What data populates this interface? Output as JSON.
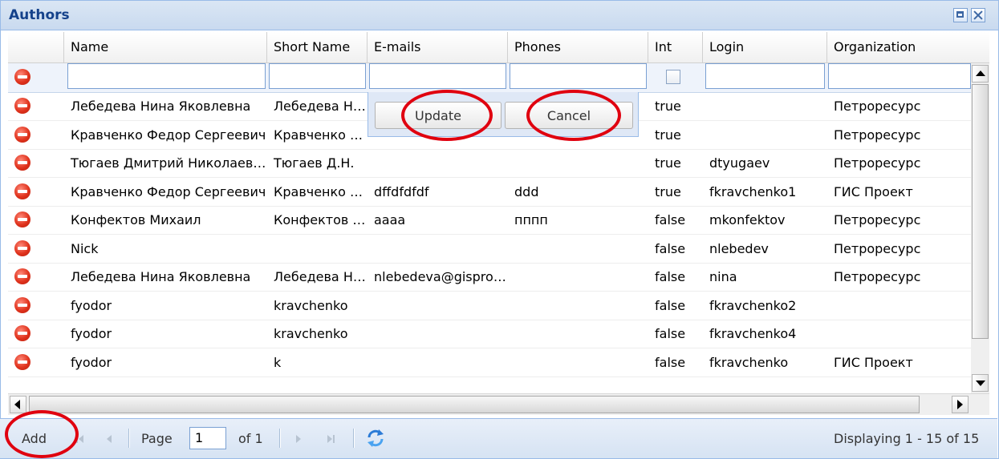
{
  "panel": {
    "title": "Authors"
  },
  "columns": [
    {
      "key": "del",
      "label": ""
    },
    {
      "key": "name",
      "label": "Name"
    },
    {
      "key": "short",
      "label": "Short Name"
    },
    {
      "key": "emails",
      "label": "E-mails"
    },
    {
      "key": "phones",
      "label": "Phones"
    },
    {
      "key": "int",
      "label": "Int"
    },
    {
      "key": "login",
      "label": "Login"
    },
    {
      "key": "org",
      "label": "Organization"
    }
  ],
  "rows": [
    {
      "name": "Лебедева Нина Яковлевна",
      "short": "Лебедева Н.Я.",
      "emails": "",
      "phones": "",
      "int": "true",
      "login": "",
      "org": "Петроресурс"
    },
    {
      "name": "Кравченко Федор Сергеевич",
      "short": "Кравченко Ф.С.",
      "emails": "",
      "phones": "",
      "int": "true",
      "login": "",
      "org": "Петроресурс"
    },
    {
      "name": "Тюгаев Дмитрий Николаевич",
      "short": "Тюгаев Д.Н.",
      "emails": "",
      "phones": "",
      "int": "true",
      "login": "dtyugaev",
      "org": "Петроресурс"
    },
    {
      "name": "Кравченко Федор Сергеевич",
      "short": "Кравченко Ф.С.",
      "emails": "dffdfdfdf",
      "phones": "ddd",
      "int": "true",
      "login": "fkravchenko1",
      "org": "ГИС Проект"
    },
    {
      "name": "Конфектов Михаил",
      "short": "Конфектов М.",
      "emails": "aaaa",
      "phones": "пппп",
      "int": "false",
      "login": "mkonfektov",
      "org": "Петроресурс"
    },
    {
      "name": "Nick",
      "short": "",
      "emails": "",
      "phones": "",
      "int": "false",
      "login": "nlebedev",
      "org": "Петроресурс"
    },
    {
      "name": "Лебедева Нина Яковлевна",
      "short": "Лебедева Н.Я.",
      "emails": "nlebedeva@gisproject.ru",
      "phones": "",
      "int": "false",
      "login": "nina",
      "org": "Петроресурс"
    },
    {
      "name": "fyodor",
      "short": "kravchenko",
      "emails": "",
      "phones": "",
      "int": "false",
      "login": "fkravchenko2",
      "org": ""
    },
    {
      "name": "fyodor",
      "short": "kravchenko",
      "emails": "",
      "phones": "",
      "int": "false",
      "login": "fkravchenko4",
      "org": ""
    },
    {
      "name": "fyodor",
      "short": "k",
      "emails": "",
      "phones": "",
      "int": "false",
      "login": "fkravchenko",
      "org": "ГИС Проект"
    }
  ],
  "editor": {
    "update_label": "Update",
    "cancel_label": "Cancel"
  },
  "pager": {
    "add_label": "Add",
    "page_label": "Page",
    "page_value": "1",
    "of_label": "of 1",
    "display_text": "Displaying 1 - 15 of 15"
  },
  "colors": {
    "annotation": "#e0000f",
    "header_text": "#15428b",
    "panel_border": "#99bbe8"
  }
}
